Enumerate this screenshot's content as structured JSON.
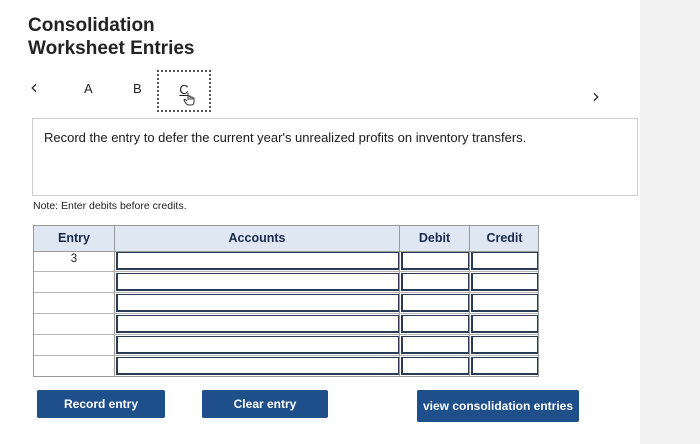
{
  "header": {
    "title_line1": "Consolidation",
    "title_line2": "Worksheet Entries"
  },
  "tabs": {
    "prev_icon": "chevron-left-icon",
    "next_icon": "chevron-right-icon",
    "items": [
      {
        "label": "A"
      },
      {
        "label": "B"
      },
      {
        "label": "C"
      }
    ],
    "active": "C"
  },
  "instruction": "Record the entry to defer the current year's unrealized profits on inventory transfers.",
  "note": "Note: Enter debits before credits.",
  "journal": {
    "columns": {
      "entry": "Entry",
      "accounts": "Accounts",
      "debit": "Debit",
      "credit": "Credit"
    },
    "rows": [
      {
        "entry": "3",
        "account": "",
        "debit": "",
        "credit": ""
      },
      {
        "entry": "",
        "account": "",
        "debit": "",
        "credit": ""
      },
      {
        "entry": "",
        "account": "",
        "debit": "",
        "credit": ""
      },
      {
        "entry": "",
        "account": "",
        "debit": "",
        "credit": ""
      },
      {
        "entry": "",
        "account": "",
        "debit": "",
        "credit": ""
      },
      {
        "entry": "",
        "account": "",
        "debit": "",
        "credit": ""
      }
    ]
  },
  "buttons": {
    "record": "Record entry",
    "clear": "Clear entry",
    "view": "view consolidation entries"
  },
  "colors": {
    "button": "#1e4f8a",
    "header_bg": "#dfe7f3"
  }
}
